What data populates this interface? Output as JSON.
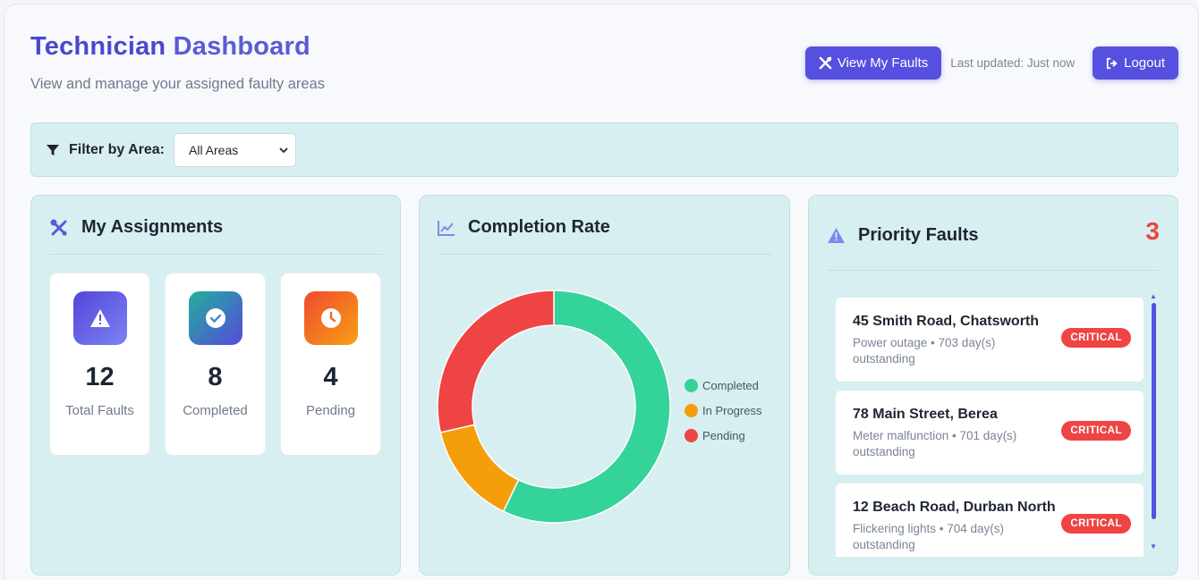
{
  "header": {
    "title_part1": "Technician",
    "title_part2": "Dashboard",
    "subtitle": "View and manage your assigned faulty areas"
  },
  "actions": {
    "view_faults_label": "View My Faults",
    "last_updated": "Last updated: Just now",
    "logout_label": "Logout"
  },
  "filter": {
    "label": "Filter by Area:",
    "selected": "All Areas"
  },
  "assignments": {
    "title": "My Assignments",
    "stats": [
      {
        "value": "12",
        "label": "Total Faults",
        "icon": "warning-icon"
      },
      {
        "value": "8",
        "label": "Completed",
        "icon": "check-badge-icon"
      },
      {
        "value": "4",
        "label": "Pending",
        "icon": "clock-icon"
      }
    ]
  },
  "completion": {
    "title": "Completion Rate"
  },
  "chart_data": {
    "type": "pie",
    "donut": true,
    "categories": [
      "Completed",
      "In Progress",
      "Pending"
    ],
    "values": [
      8,
      2,
      4
    ],
    "colors": [
      "#34d399",
      "#f59e0b",
      "#ef4444"
    ],
    "legend_position": "right"
  },
  "priority": {
    "title": "Priority Faults",
    "count": "3",
    "faults": [
      {
        "address": "45 Smith Road, Chatsworth",
        "desc": "Power outage • 703 day(s) outstanding",
        "badge": "CRITICAL"
      },
      {
        "address": "78 Main Street, Berea",
        "desc": "Meter malfunction • 701 day(s) outstanding",
        "badge": "CRITICAL"
      },
      {
        "address": "12 Beach Road, Durban North",
        "desc": "Flickering lights • 704 day(s) outstanding",
        "badge": "CRITICAL"
      }
    ]
  }
}
